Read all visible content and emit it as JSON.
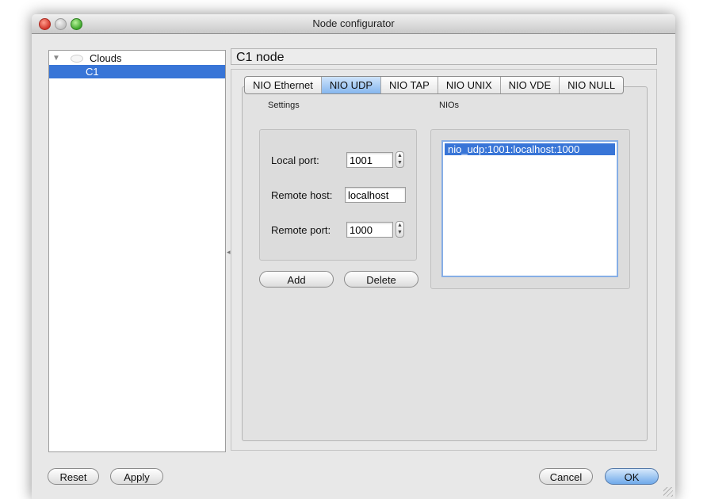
{
  "window": {
    "title": "Node configurator"
  },
  "tree": {
    "parent_label": "Clouds",
    "child_label": "C1"
  },
  "node_title": "C1 node",
  "tabs": [
    {
      "label": "NIO Ethernet",
      "active": false
    },
    {
      "label": "NIO UDP",
      "active": true
    },
    {
      "label": "NIO TAP",
      "active": false
    },
    {
      "label": "NIO UNIX",
      "active": false
    },
    {
      "label": "NIO VDE",
      "active": false
    },
    {
      "label": "NIO NULL",
      "active": false
    }
  ],
  "settings": {
    "title": "Settings",
    "local_port_label": "Local port:",
    "local_port_value": "1001",
    "remote_host_label": "Remote host:",
    "remote_host_value": "localhost",
    "remote_port_label": "Remote port:",
    "remote_port_value": "1000"
  },
  "actions": {
    "add_label": "Add",
    "delete_label": "Delete"
  },
  "nios": {
    "title": "NIOs",
    "items": [
      "nio_udp:1001:localhost:1000"
    ]
  },
  "footer": {
    "reset_label": "Reset",
    "apply_label": "Apply",
    "cancel_label": "Cancel",
    "ok_label": "OK"
  },
  "colors": {
    "selection": "#3875d7",
    "active_tab": "#85b6ee"
  }
}
